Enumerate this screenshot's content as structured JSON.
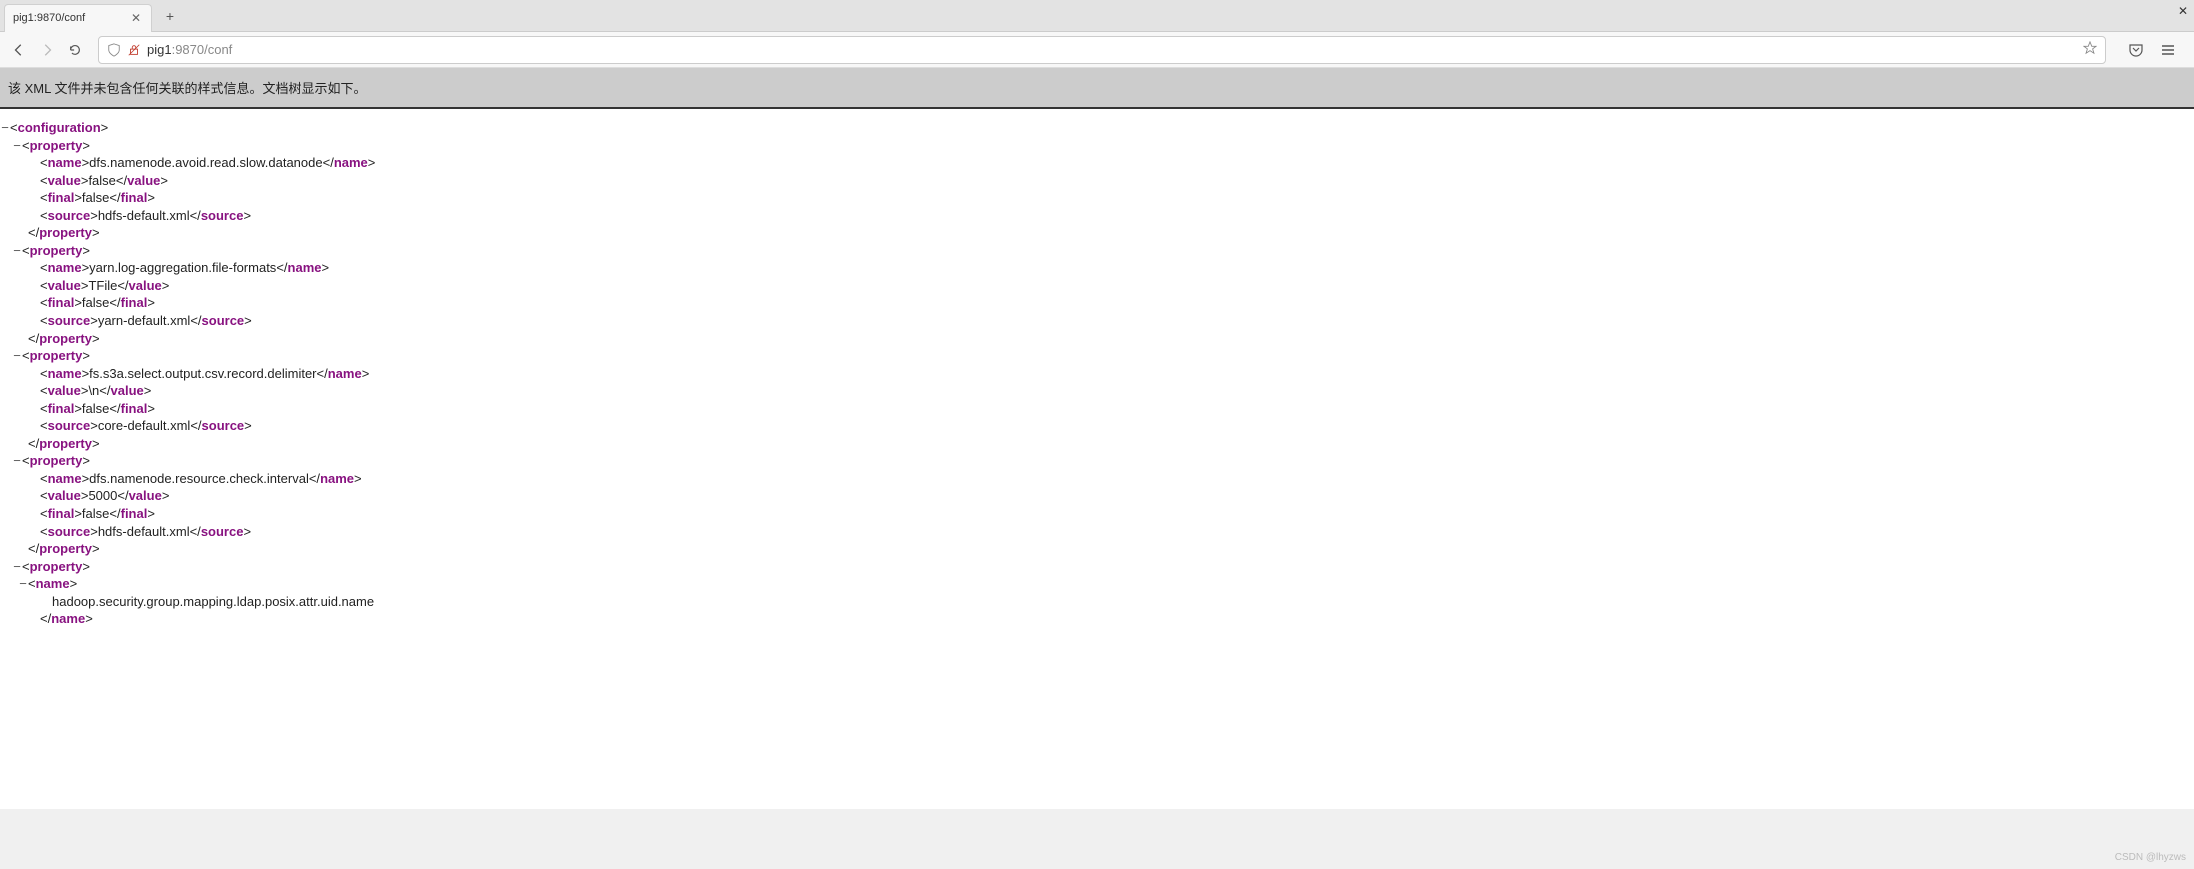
{
  "tab": {
    "title": "pig1:9870/conf"
  },
  "url": {
    "host": "pig1",
    "rest": ":9870/conf"
  },
  "banner": "该 XML 文件并未包含任何关联的样式信息。文档树显示如下。",
  "watermark": "CSDN @lhyzws",
  "xml": {
    "root": "configuration",
    "properties": [
      {
        "name": "dfs.namenode.avoid.read.slow.datanode",
        "value": "false",
        "final": "false",
        "source": "hdfs-default.xml"
      },
      {
        "name": "yarn.log-aggregation.file-formats",
        "value": "TFile",
        "final": "false",
        "source": "yarn-default.xml"
      },
      {
        "name": "fs.s3a.select.output.csv.record.delimiter",
        "value": "\\n",
        "final": "false",
        "source": "core-default.xml"
      },
      {
        "name": "dfs.namenode.resource.check.interval",
        "value": "5000",
        "final": "false",
        "source": "hdfs-default.xml"
      }
    ],
    "partial": {
      "name": "hadoop.security.group.mapping.ldap.posix.attr.uid.name"
    }
  },
  "tags": {
    "property": "property",
    "name": "name",
    "value": "value",
    "final": "final",
    "source": "source"
  }
}
